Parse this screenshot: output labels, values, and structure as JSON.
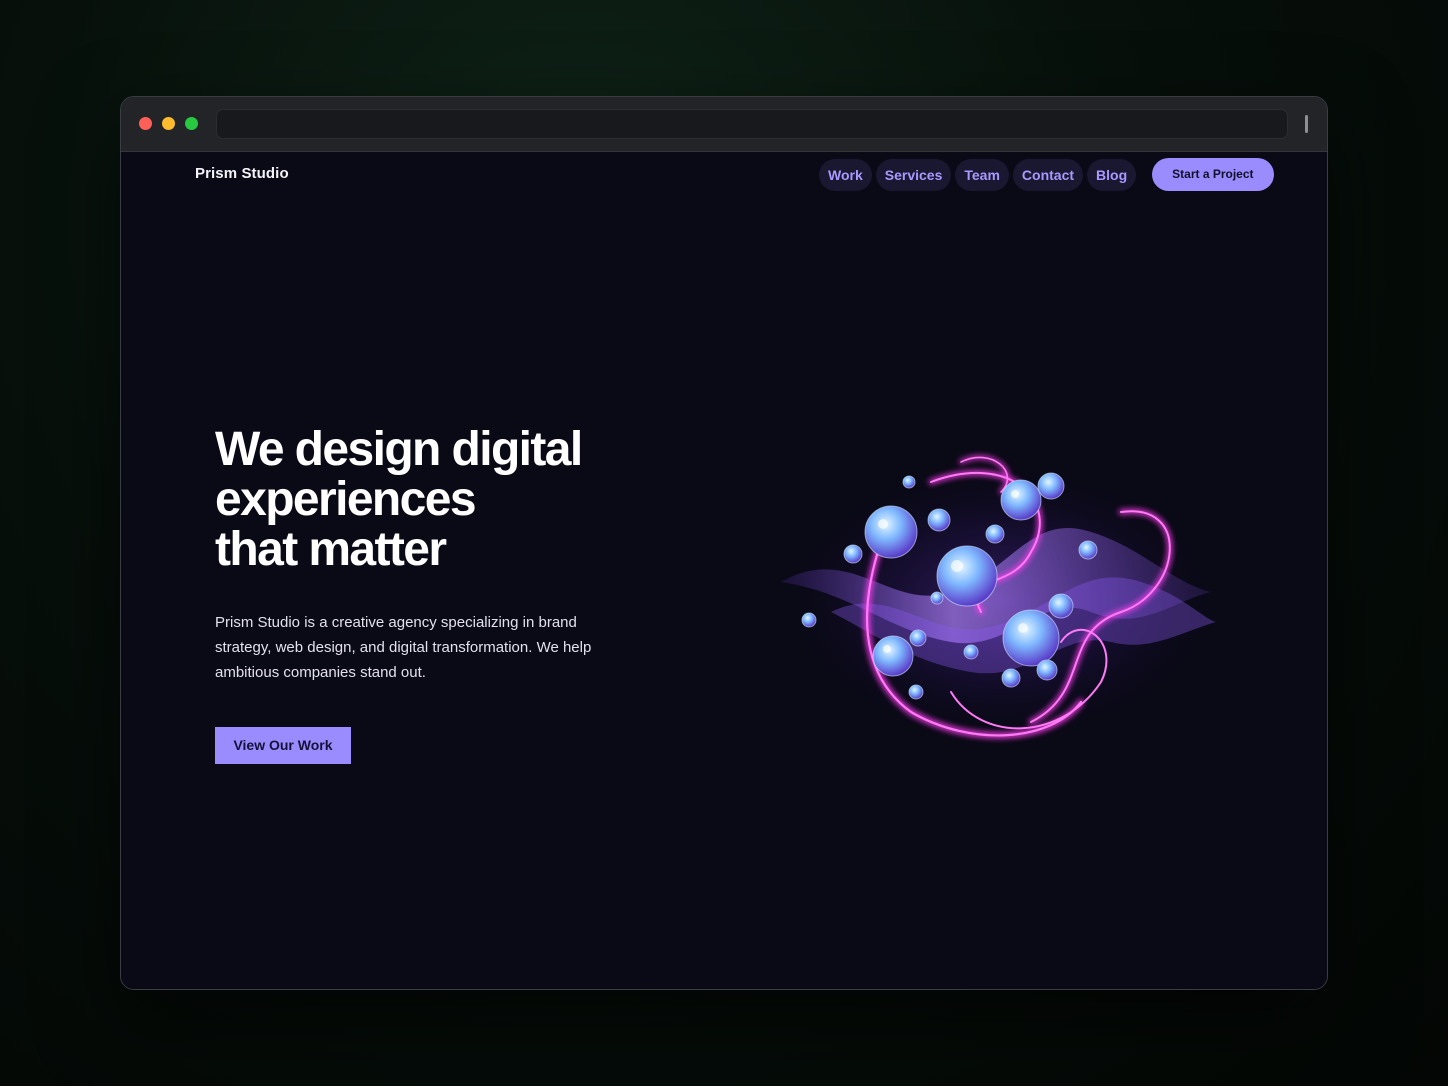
{
  "nav": {
    "brand": "Prism Studio",
    "links": [
      "Work",
      "Services",
      "Team",
      "Contact",
      "Blog"
    ],
    "cta_label": "Start a Project"
  },
  "hero": {
    "title_lines": [
      "We design digital",
      "experiences",
      "that matter"
    ],
    "description": "Prism Studio is a creative agency specializing in brand strategy, web design, and digital transformation. We help ambitious companies stand out.",
    "button_label": "View Our Work"
  },
  "art": {
    "icon": "prism-abstract-illustration",
    "colors": {
      "ribbon": "#ff3cf2",
      "wave": "#9b6bff",
      "crystal": "#7fd8ff"
    }
  },
  "colors": {
    "accent": "#9a8cff",
    "nav_text": "#a799ff",
    "background": "#0a0916"
  }
}
